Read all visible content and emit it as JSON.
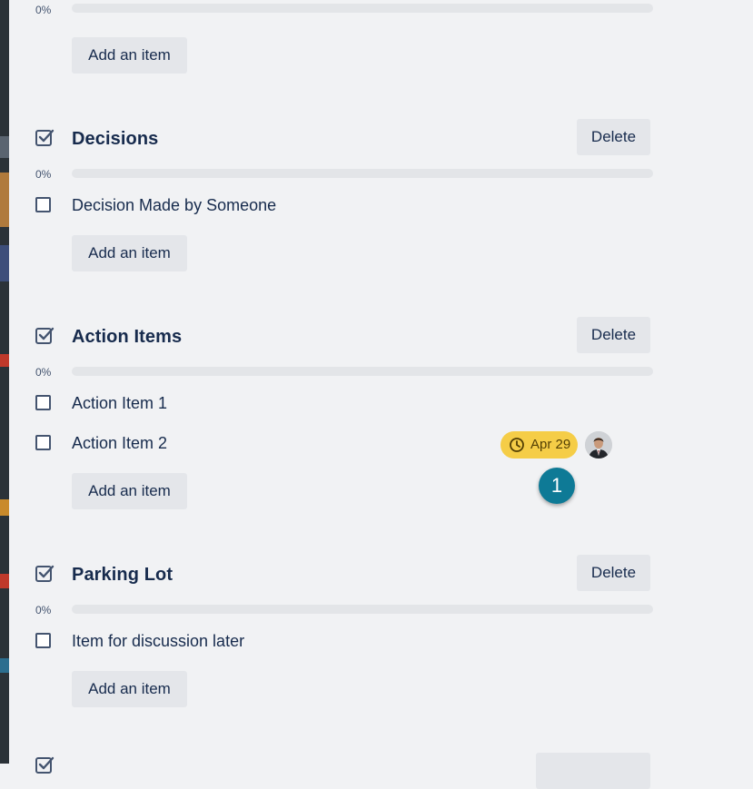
{
  "top_checklist": {
    "progress_label": "0%",
    "progress_fraction": 0,
    "add_item_label": "Add an item"
  },
  "checklists": [
    {
      "title": "Decisions",
      "delete_label": "Delete",
      "progress_label": "0%",
      "progress_fraction": 0,
      "items": [
        {
          "label": "Decision Made by Someone"
        }
      ],
      "add_item_label": "Add an item"
    },
    {
      "title": "Action Items",
      "delete_label": "Delete",
      "progress_label": "0%",
      "progress_fraction": 0,
      "items": [
        {
          "label": "Action Item 1"
        },
        {
          "label": "Action Item 2",
          "due_date": "Apr 29",
          "has_assignee": true
        }
      ],
      "add_item_label": "Add an item"
    },
    {
      "title": "Parking Lot",
      "delete_label": "Delete",
      "progress_label": "0%",
      "progress_fraction": 0,
      "items": [
        {
          "label": "Item for discussion later"
        }
      ],
      "add_item_label": "Add an item"
    }
  ],
  "step_marker": "1",
  "colors": {
    "panel_background": "#f1f2f4",
    "button_background": "#e4e6ea",
    "due_badge": "#f5cd47",
    "step_marker": "#0e7a96",
    "text": "#172b4d"
  },
  "icons": {
    "checklist": "checklist-icon",
    "due": "clock-icon"
  }
}
